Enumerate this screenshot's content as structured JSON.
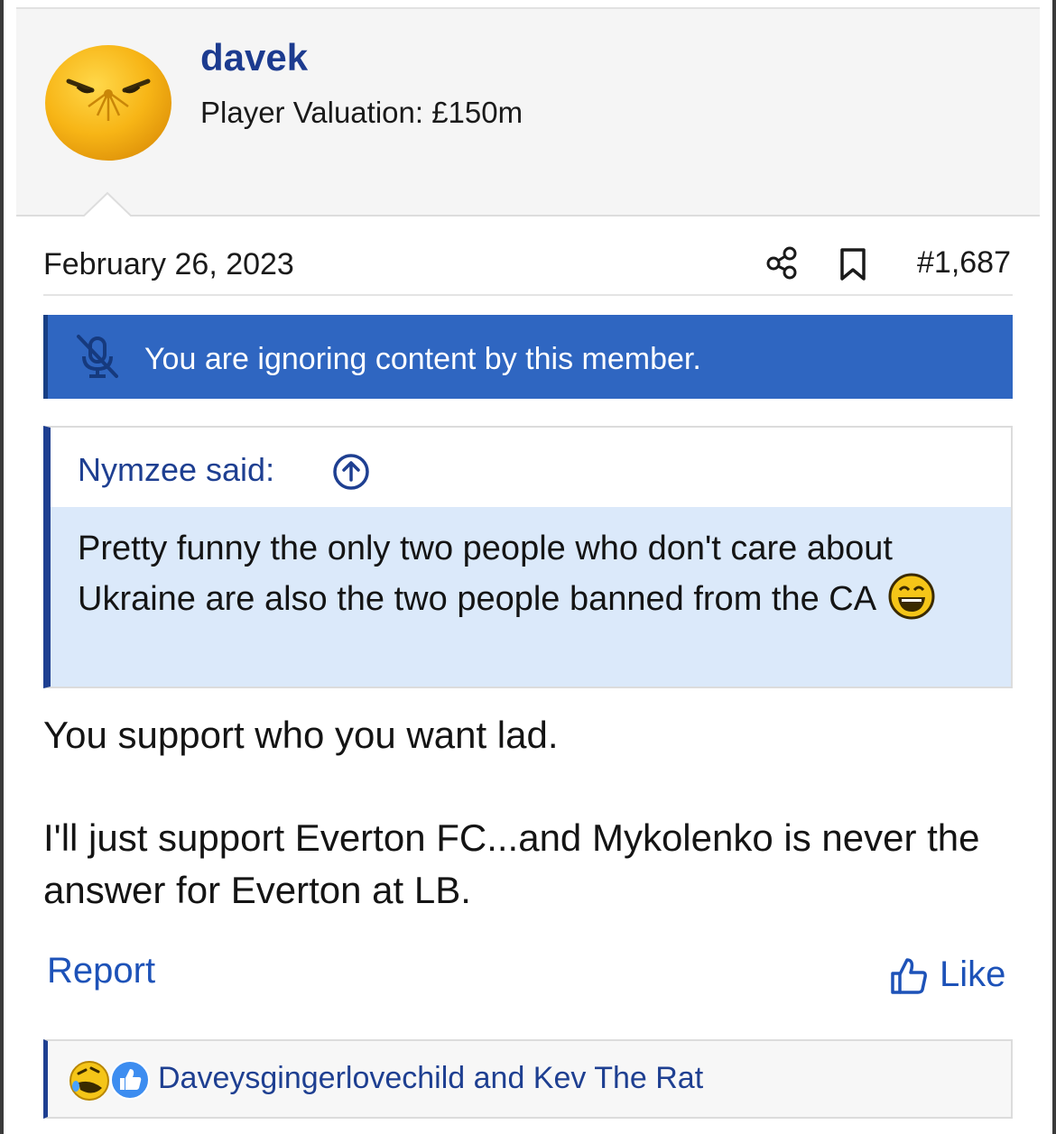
{
  "user": {
    "name": "davek",
    "title": "Player Valuation: £150m",
    "avatar": "orange-face-avatar"
  },
  "post": {
    "date": "February 26, 2023",
    "number": "#1,687",
    "icons": [
      "share-icon",
      "bookmark-icon"
    ]
  },
  "ignore_notice": {
    "text": "You are ignoring content by this member.",
    "icon": "muted-microphone-icon"
  },
  "quote": {
    "author": "Nymzee said:",
    "text": "Pretty funny the only two people who don't care about Ukraine are also the two people banned from the CA",
    "emoji": "laughing-emoji"
  },
  "body": {
    "paragraph1": "You support who you want lad.",
    "paragraph2": "I'll just support Everton FC...and Mykolenko is never the answer for Everton at LB."
  },
  "actions": {
    "report": "Report",
    "like": "Like"
  },
  "reactions": {
    "text": "Daveysgingerlovechild and Kev The Rat",
    "icons": [
      "rofl-reaction-icon",
      "like-reaction-icon"
    ]
  },
  "colors": {
    "username": "#1c3b8f",
    "link": "#1d52b8",
    "notice_bg": "#2f66c1",
    "quote_border": "#1e3f91",
    "quote_bg": "#dbe9fa"
  }
}
